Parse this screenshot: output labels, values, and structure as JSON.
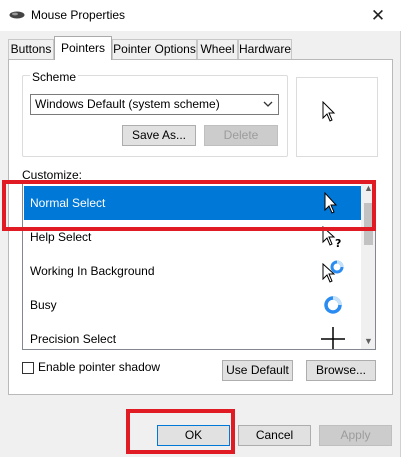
{
  "window": {
    "title": "Mouse Properties",
    "title_icon": "mouse-icon",
    "close_glyph": "✕"
  },
  "tabs": [
    {
      "label": "Buttons"
    },
    {
      "label": "Pointers"
    },
    {
      "label": "Pointer Options"
    },
    {
      "label": "Wheel"
    },
    {
      "label": "Hardware"
    }
  ],
  "active_tab": "Pointers",
  "scheme": {
    "group_label": "Scheme",
    "selected": "Windows Default (system scheme)",
    "save_as_label": "Save As...",
    "delete_label": "Delete"
  },
  "customize": {
    "label": "Customize:",
    "items": [
      {
        "label": "Normal Select",
        "icon": "arrow-cursor-icon",
        "selected": true
      },
      {
        "label": "Help Select",
        "icon": "help-cursor-icon",
        "selected": false
      },
      {
        "label": "Working In Background",
        "icon": "working-cursor-icon",
        "selected": false
      },
      {
        "label": "Busy",
        "icon": "busy-ring-icon",
        "selected": false
      },
      {
        "label": "Precision Select",
        "icon": "crosshair-icon",
        "selected": false
      }
    ]
  },
  "pointer_shadow": {
    "label": "Enable pointer shadow",
    "checked": false
  },
  "buttons": {
    "use_default": "Use Default",
    "browse": "Browse...",
    "ok": "OK",
    "cancel": "Cancel",
    "apply": "Apply"
  },
  "colors": {
    "selection": "#0078d7",
    "highlight": "#e01b24"
  }
}
